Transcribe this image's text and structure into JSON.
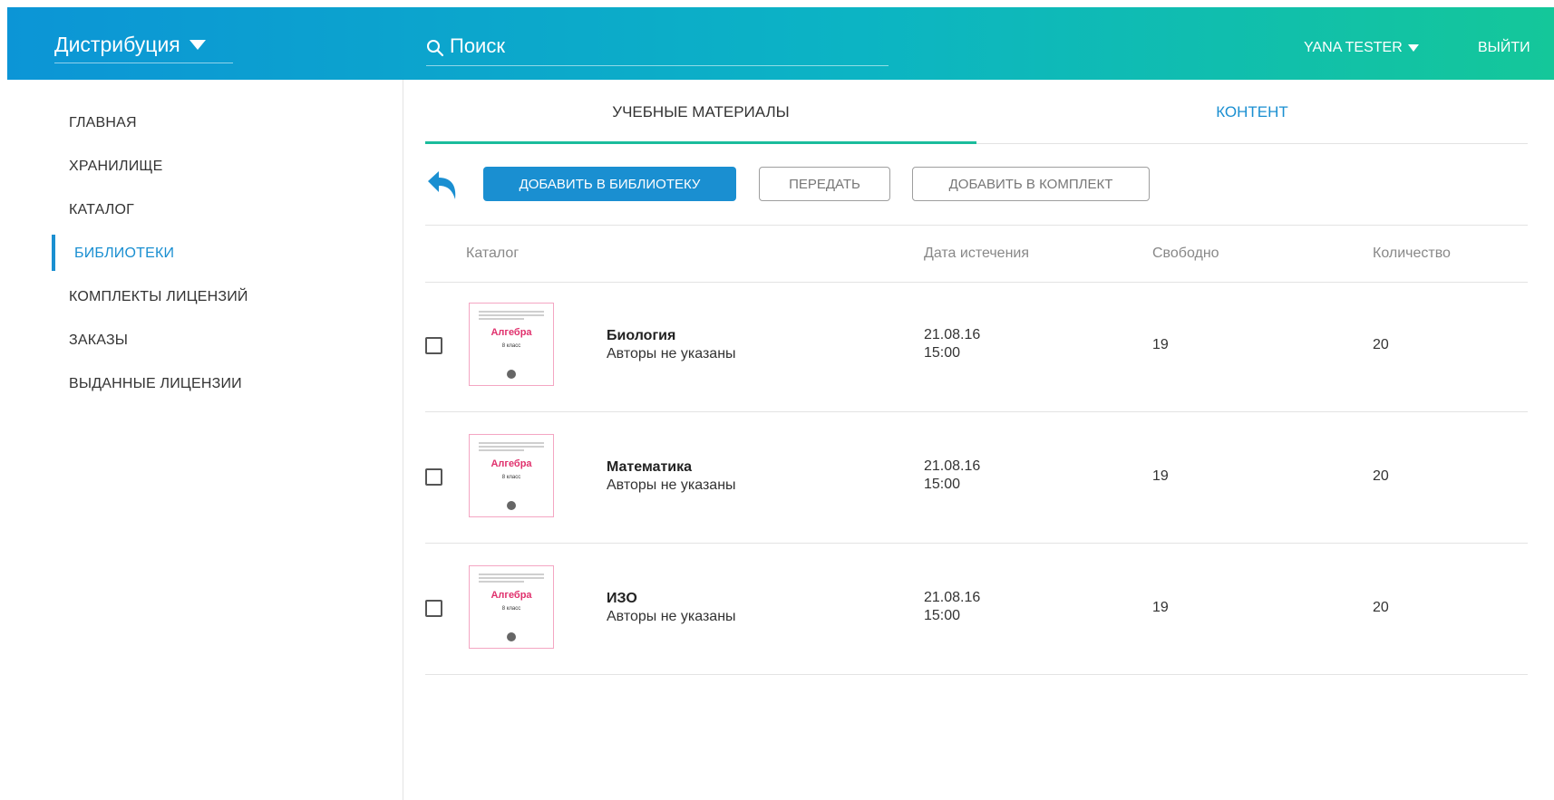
{
  "header": {
    "app_switcher_label": "Дистрибуция",
    "search_placeholder": "Поиск",
    "user_name": "YANA TESTER",
    "logout_label": "ВЫЙТИ"
  },
  "sidebar": {
    "items": [
      {
        "label": "ГЛАВНАЯ"
      },
      {
        "label": "ХРАНИЛИЩЕ"
      },
      {
        "label": "КАТАЛОГ"
      },
      {
        "label": "БИБЛИОТЕКИ",
        "active": true
      },
      {
        "label": "КОМПЛЕКТЫ ЛИЦЕНЗИЙ"
      },
      {
        "label": "ЗАКАЗЫ"
      },
      {
        "label": "ВЫДАННЫЕ ЛИЦЕНЗИИ"
      }
    ]
  },
  "tabs": [
    {
      "label": "УЧЕБНЫЕ МАТЕРИАЛЫ",
      "active": true
    },
    {
      "label": "КОНТЕНТ",
      "active": false
    }
  ],
  "toolbar": {
    "add_to_library_label": "ДОБАВИТЬ В БИБЛИОТЕКУ",
    "transfer_label": "ПЕРЕДАТЬ",
    "add_to_kit_label": "ДОБАВИТЬ В КОМПЛЕКТ"
  },
  "table": {
    "columns": [
      "Каталог",
      "Дата истечения",
      "Свободно",
      "Количество"
    ],
    "rows": [
      {
        "cover_title": "Алгебра",
        "cover_grade": "8 класс",
        "title": "Биология",
        "authors": "Авторы не указаны",
        "date": "21.08.16",
        "time": "15:00",
        "free": "19",
        "quantity": "20"
      },
      {
        "cover_title": "Алгебра",
        "cover_grade": "8 класс",
        "title": "Математика",
        "authors": "Авторы не указаны",
        "date": "21.08.16",
        "time": "15:00",
        "free": "19",
        "quantity": "20"
      },
      {
        "cover_title": "Алгебра",
        "cover_grade": "8 класс",
        "title": "ИЗО",
        "authors": "Авторы не указаны",
        "date": "21.08.16",
        "time": "15:00",
        "free": "19",
        "quantity": "20"
      }
    ]
  },
  "colors": {
    "accent": "#1a8fd1",
    "tab_underline": "#1abc9c",
    "header_gradient_start": "#0c95d6",
    "header_gradient_end": "#14c79a",
    "cover_accent": "#e0316d"
  }
}
